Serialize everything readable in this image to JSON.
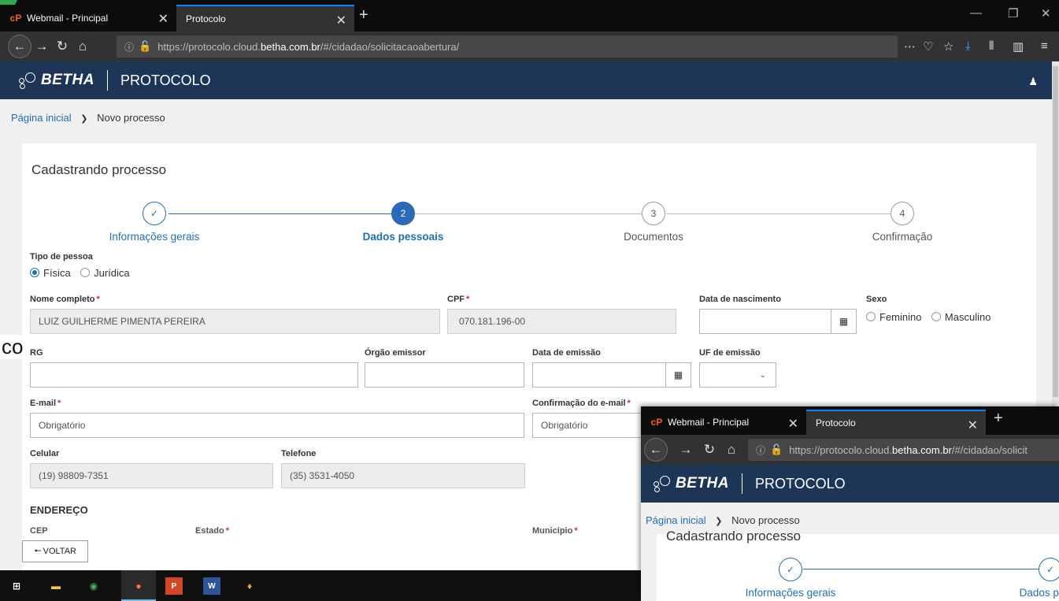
{
  "browser": {
    "tabs": [
      {
        "label": "Webmail - Principal",
        "active": false
      },
      {
        "label": "Protocolo",
        "active": true
      }
    ],
    "url_prefix": "https://protocolo.cloud.",
    "url_host": "betha.com.br",
    "url_path": "/#/cidadao/solicitacaoabertura/"
  },
  "app": {
    "brand": "BETHA",
    "product": "PROTOCOLO"
  },
  "breadcrumb": {
    "home": "Página inicial",
    "current": "Novo processo"
  },
  "form": {
    "title": "Cadastrando processo",
    "steps": [
      {
        "num": "✓",
        "label": "Informações gerais",
        "state": "done"
      },
      {
        "num": "2",
        "label": "Dados pessoais",
        "state": "active"
      },
      {
        "num": "3",
        "label": "Documentos",
        "state": "todo"
      },
      {
        "num": "4",
        "label": "Confirmação",
        "state": "todo"
      }
    ],
    "tipo_pessoa": {
      "label": "Tipo de pessoa",
      "options": [
        "Física",
        "Jurídica"
      ],
      "selected": "Física"
    },
    "nome": {
      "label": "Nome completo",
      "value": "LUIZ GUILHERME PIMENTA PEREIRA"
    },
    "cpf": {
      "label": "CPF",
      "value": "070.181.196-00"
    },
    "nascimento": {
      "label": "Data de nascimento",
      "value": ""
    },
    "sexo": {
      "label": "Sexo",
      "options": [
        "Feminino",
        "Masculino"
      ]
    },
    "rg": {
      "label": "RG",
      "value": ""
    },
    "orgao": {
      "label": "Órgão emissor",
      "value": ""
    },
    "data_emissao": {
      "label": "Data de emissão",
      "value": ""
    },
    "uf_emissao": {
      "label": "UF de emissão",
      "value": ""
    },
    "email": {
      "label": "E-mail",
      "placeholder": "Obrigatório"
    },
    "email_confirm": {
      "label": "Confirmação do e-mail",
      "placeholder": "Obrigatório"
    },
    "celular": {
      "label": "Celular",
      "value": "(19) 98809-7351"
    },
    "telefone": {
      "label": "Telefone",
      "value": "(35) 3531-4050"
    },
    "endereco_title": "ENDEREÇO",
    "cep_label": "CEP",
    "estado_label": "Estado",
    "municipio_label": "Município"
  },
  "back_button": "VOLTAR",
  "side_text": "co",
  "overlay": {
    "tabs": [
      "Webmail - Principal",
      "Protocolo"
    ],
    "url_prefix": "https://protocolo.cloud.",
    "url_host": "betha.com.br",
    "url_path": "/#/cidadao/solicit",
    "brand": "BETHA",
    "product": "PROTOCOLO",
    "crumb_home": "Página inicial",
    "crumb_current": "Novo processo",
    "title": "Cadastrando processo",
    "step1": "Informações gerais",
    "step2": "Dados pesso"
  }
}
